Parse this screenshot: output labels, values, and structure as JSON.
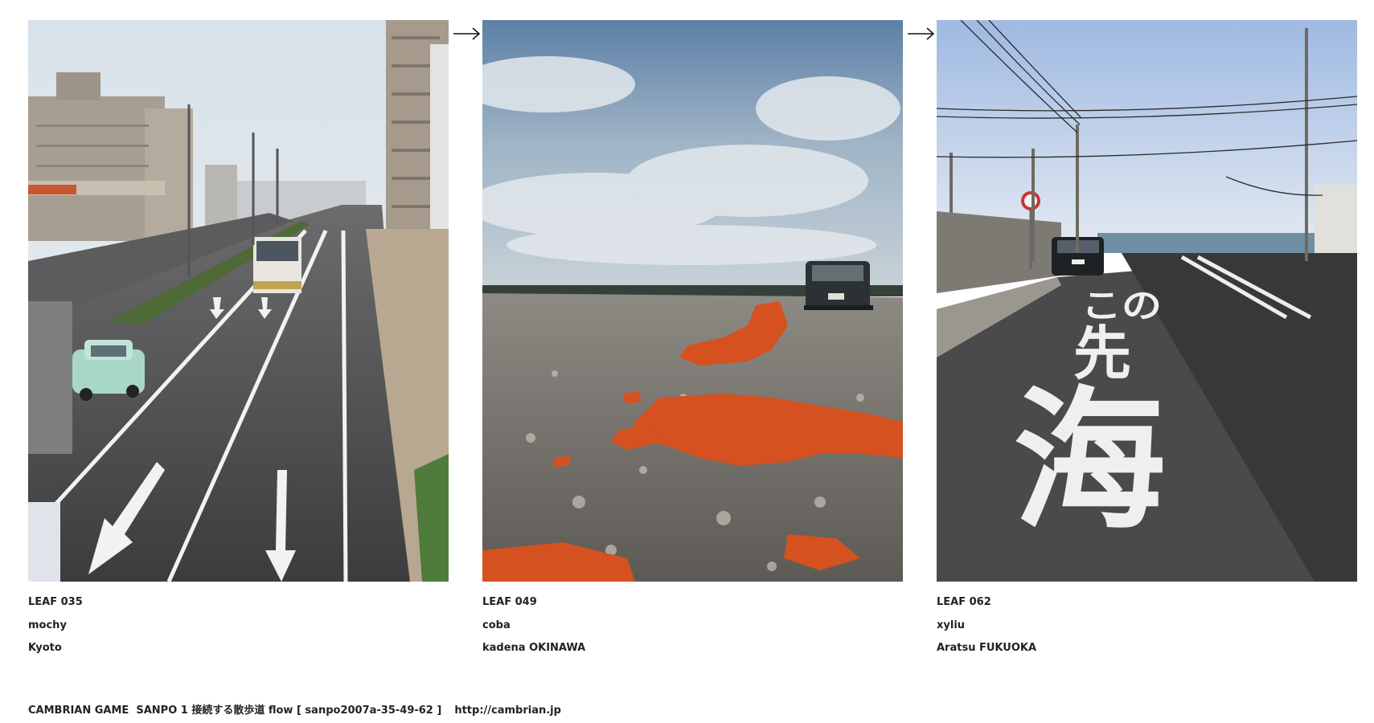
{
  "leaves": [
    {
      "id": "LEAF 035",
      "author": "mochy",
      "location": "Kyoto"
    },
    {
      "id": "LEAF 049",
      "author": "coba",
      "location": "kadena OKINAWA"
    },
    {
      "id": "LEAF 062",
      "author": "xyliu",
      "location": "Aratsu FUKUOKA"
    }
  ],
  "flow_arrow_icon": "right-arrow-icon",
  "footer": {
    "credit": "CAMBRIAN GAME  SANPO 1 接続する散歩道 flow [ sanpo2007a-35-49-62 ]",
    "url": "http://cambrian.jp"
  },
  "road_marking_text": [
    "この",
    "先",
    "海"
  ]
}
